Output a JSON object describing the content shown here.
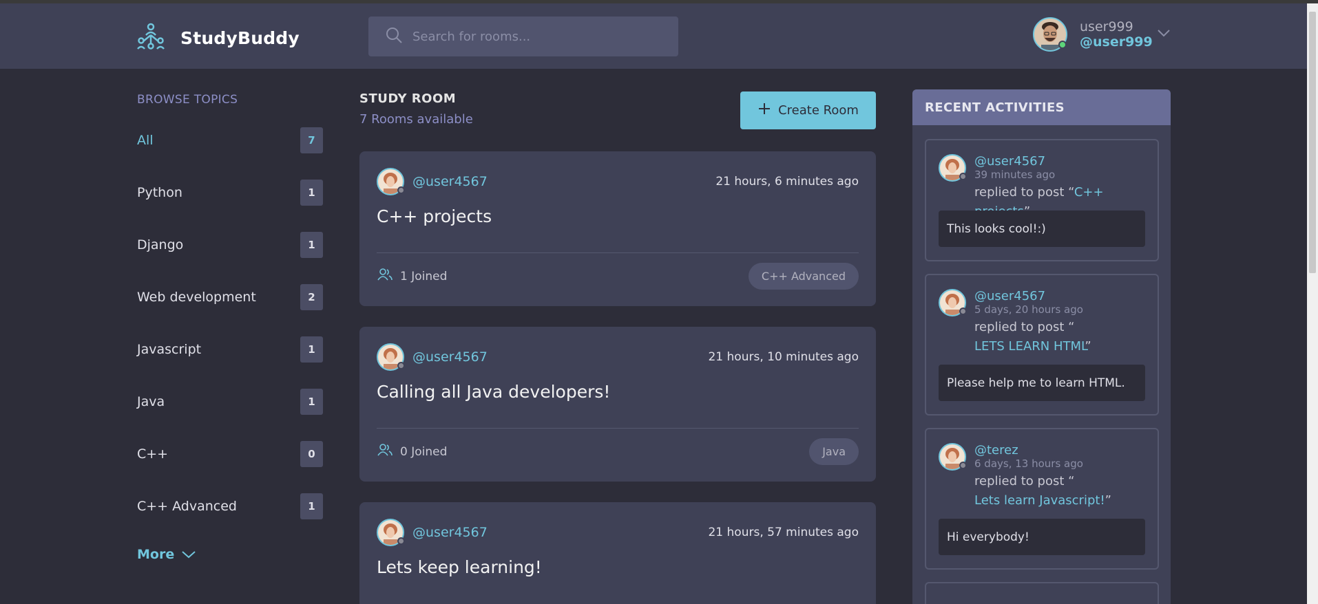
{
  "header": {
    "logo_text": "StudyBuddy",
    "search_placeholder": "Search for rooms...",
    "user": {
      "name": "user999",
      "handle": "@user999"
    }
  },
  "sidebar": {
    "title": "BROWSE TOPICS",
    "topics": [
      {
        "label": "All",
        "count": "7"
      },
      {
        "label": "Python",
        "count": "1"
      },
      {
        "label": "Django",
        "count": "1"
      },
      {
        "label": "Web development",
        "count": "2"
      },
      {
        "label": "Javascript",
        "count": "1"
      },
      {
        "label": "Java",
        "count": "1"
      },
      {
        "label": "C++",
        "count": "0"
      },
      {
        "label": "C++ Advanced",
        "count": "1"
      }
    ],
    "more_label": "More"
  },
  "main": {
    "title": "STUDY ROOM",
    "subtitle": "7 Rooms available",
    "create_label": "Create Room",
    "rooms": [
      {
        "author": "@user4567",
        "time": "21 hours, 6 minutes ago",
        "title": "C++ projects",
        "joined": "1 Joined",
        "tag": "C++ Advanced"
      },
      {
        "author": "@user4567",
        "time": "21 hours, 10 minutes ago",
        "title": "Calling all Java developers!",
        "joined": "0 Joined",
        "tag": "Java"
      },
      {
        "author": "@user4567",
        "time": "21 hours, 57 minutes ago",
        "title": "Lets keep learning!"
      }
    ]
  },
  "recent": {
    "title": "RECENT ACTIVITIES",
    "items": [
      {
        "handle": "@user4567",
        "time": "39 minutes ago",
        "action": "replied to post “",
        "post": "C++ projects",
        "close": "”",
        "message": "This looks cool!:)"
      },
      {
        "handle": "@user4567",
        "time": "5 days, 20 hours ago",
        "action": "replied to post “",
        "post": "LETS LEARN HTML",
        "close": "”",
        "message": "Please help me to learn HTML."
      },
      {
        "handle": "@terez",
        "time": "6 days, 13 hours ago",
        "action": "replied to post “",
        "post": "Lets learn Javascript!",
        "close": "”",
        "message": "Hi everybody!"
      }
    ]
  },
  "colors": {
    "accent": "#71c6dd",
    "background": "#2d2d39",
    "panel": "#3f4156",
    "recent_header": "#696d97"
  },
  "icons": {
    "logo": "people-network-icon",
    "search": "search-icon",
    "chevron": "chevron-down-icon",
    "plus": "plus-icon",
    "joined": "users-icon"
  }
}
